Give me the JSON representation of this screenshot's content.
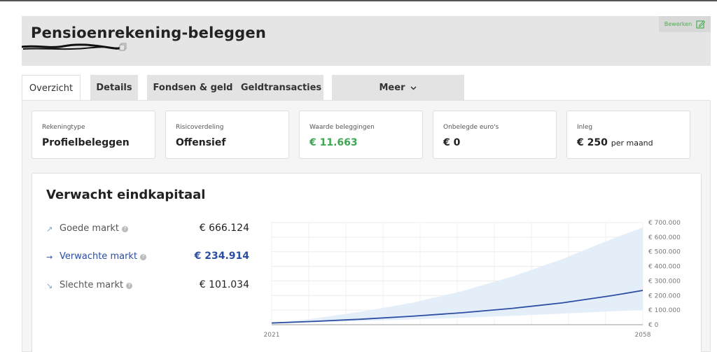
{
  "header": {
    "title": "Pensioenrekening-beleggen",
    "edit_label": "Bewerken"
  },
  "tabs": [
    {
      "label": "Overzicht",
      "active": true
    },
    {
      "label": "Details"
    },
    {
      "label": "Fondsen & geld"
    },
    {
      "label": "Geldtransacties"
    },
    {
      "label": "Meer"
    }
  ],
  "cards": [
    {
      "label": "Rekeningtype",
      "value": "Profielbeleggen"
    },
    {
      "label": "Risicoverdeling",
      "value": "Offensief"
    },
    {
      "label": "Waarde beleggingen",
      "value": "€ 11.663"
    },
    {
      "label": "Onbelegde euro's",
      "value": "€ 0"
    },
    {
      "label": "Inleg",
      "value": "€ 250",
      "suffix": "per maand"
    }
  ],
  "projection": {
    "title": "Verwacht eindkapitaal",
    "rows": [
      {
        "label": "Goede markt",
        "amount": "€ 666.124",
        "icon": "arrow-up-right-icon"
      },
      {
        "label": "Verwachte markt",
        "amount": "€ 234.914",
        "icon": "arrow-right-icon"
      },
      {
        "label": "Slechte markt",
        "amount": "€ 101.034",
        "icon": "arrow-down-right-icon"
      }
    ]
  },
  "colors": {
    "accent_green": "#3fa654",
    "expected_blue": "#2b4ea3",
    "band": "#e3eef8"
  },
  "chart_data": {
    "type": "area",
    "x": [
      2021,
      2025,
      2030,
      2035,
      2040,
      2045,
      2050,
      2055,
      2058
    ],
    "series": [
      {
        "name": "Goede markt",
        "values": [
          11663,
          40000,
          90000,
          150000,
          230000,
          330000,
          450000,
          590000,
          666124
        ]
      },
      {
        "name": "Verwachte markt",
        "values": [
          11663,
          22000,
          38000,
          58000,
          82000,
          112000,
          150000,
          200000,
          234914
        ]
      },
      {
        "name": "Slechte markt",
        "values": [
          11663,
          16000,
          25000,
          36000,
          48000,
          61000,
          76000,
          92000,
          101034
        ]
      }
    ],
    "xticks": [
      "2021",
      "2058"
    ],
    "yticks": [
      "€ 0",
      "€ 100.000",
      "€ 200.000",
      "€ 300.000",
      "€ 400.000",
      "€ 500.000",
      "€ 600.000",
      "€ 700.000"
    ],
    "ytick_values": [
      0,
      100000,
      200000,
      300000,
      400000,
      500000,
      600000,
      700000
    ],
    "ylim": [
      0,
      700000
    ],
    "xlim": [
      2021,
      2058
    ],
    "grid": true
  }
}
